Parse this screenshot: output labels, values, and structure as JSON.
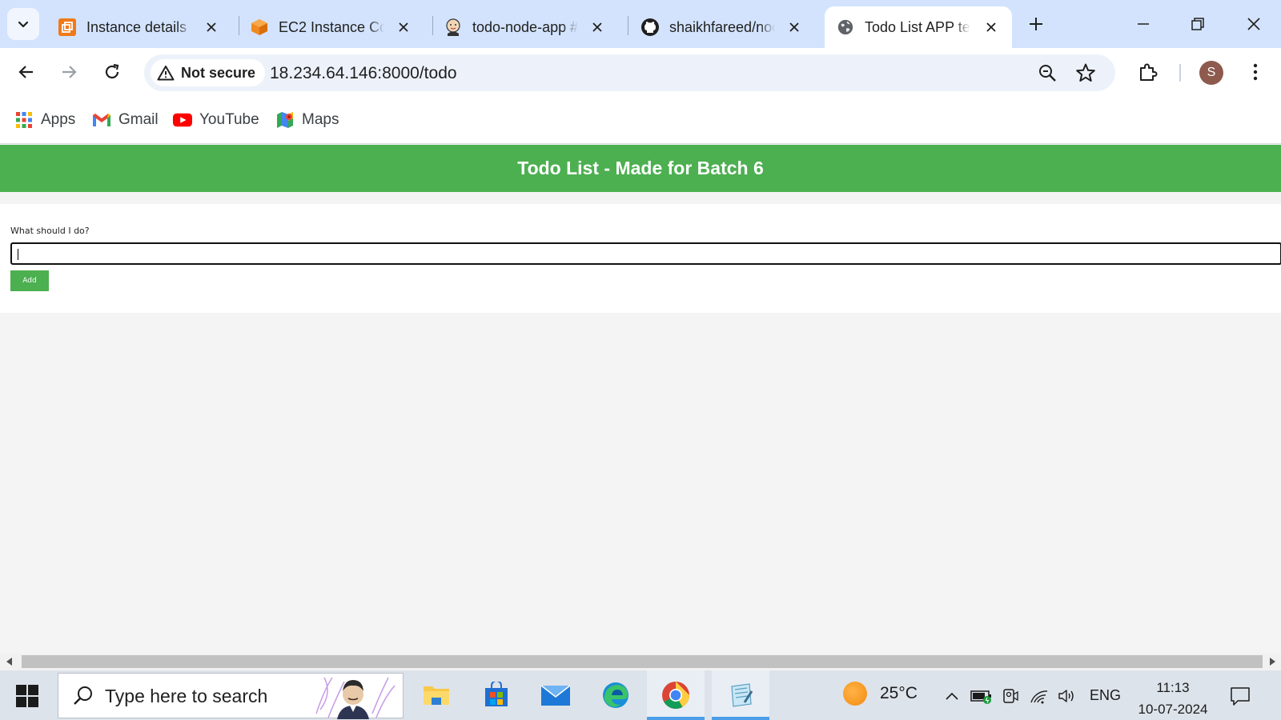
{
  "browser": {
    "tabs": [
      {
        "title": "Instance details |",
        "icon": "aws-instance-icon"
      },
      {
        "title": "EC2 Instance Con",
        "icon": "ec2-cube-icon"
      },
      {
        "title": "todo-node-app #",
        "icon": "jenkins-icon"
      },
      {
        "title": "shaikhfareed/noc",
        "icon": "github-icon"
      },
      {
        "title": "Todo List APP tes",
        "icon": "globe-icon",
        "active": true
      }
    ],
    "security_label": "Not secure",
    "url": "18.234.64.146:8000/todo",
    "profile_initial": "S",
    "bookmarks": [
      {
        "label": "Apps",
        "icon": "apps-grid-icon"
      },
      {
        "label": "Gmail",
        "icon": "gmail-icon"
      },
      {
        "label": "YouTube",
        "icon": "youtube-icon"
      },
      {
        "label": "Maps",
        "icon": "maps-icon"
      }
    ]
  },
  "page": {
    "header_title": "Todo List - Made for Batch 6",
    "form_label": "What should I do?",
    "input_value": "",
    "add_button": "Add",
    "accent_color": "#4caf50"
  },
  "taskbar": {
    "search_placeholder": "Type here to search",
    "apps": [
      "file-explorer-icon",
      "microsoft-store-icon",
      "mail-icon",
      "edge-icon",
      "chrome-icon",
      "notepad-icon"
    ],
    "temperature": "25°C",
    "language": "ENG",
    "time": "11:13",
    "date": "10-07-2024"
  }
}
